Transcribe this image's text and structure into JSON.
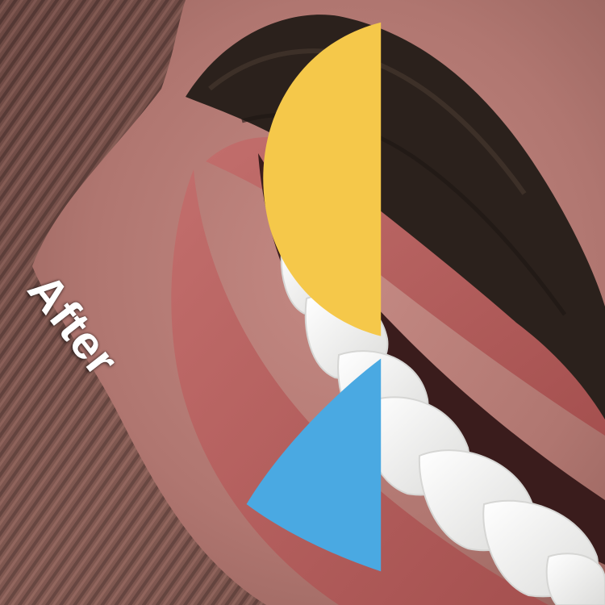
{
  "photo": {
    "subject": "smiling-mouth-closeup",
    "overlay_label": "After"
  },
  "colors": {
    "skin": "#b07670",
    "lip": "#b25e5e",
    "teeth": "#f1f1ef",
    "mustache": "#2b211c",
    "background_stripes": "#6e4a44",
    "logo_yellow": "#f5c84a",
    "logo_blue": "#4aa9e2"
  }
}
